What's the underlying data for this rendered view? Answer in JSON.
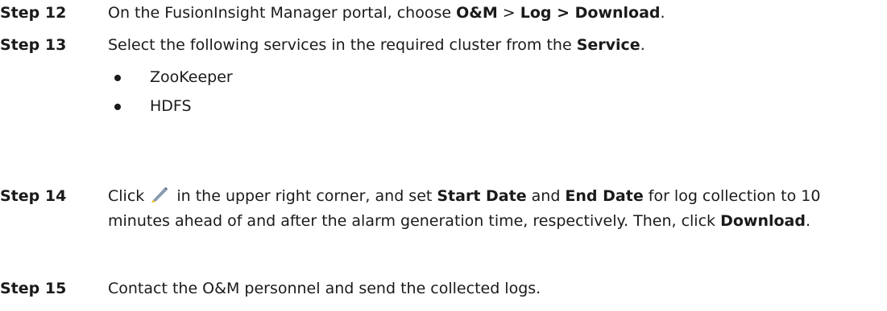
{
  "steps": [
    {
      "label": "Step 12",
      "text_1": "On the FusionInsight Manager portal, choose ",
      "bold_1": "O&M",
      "text_2": " > ",
      "bold_2": "Log > Download",
      "text_3": "."
    },
    {
      "label": "Step 13",
      "text_1": "Select the following services in the required cluster from the ",
      "bold_1": "Service",
      "text_2": ".",
      "bullets": [
        "ZooKeeper",
        "HDFS"
      ]
    },
    {
      "label": "Step 14",
      "text_1": "Click ",
      "icon": "pencil-edit-icon",
      "text_2": " in the upper right corner, and set ",
      "bold_1": "Start Date",
      "text_3": " and ",
      "bold_2": "End Date",
      "text_4": " for log collection to 10 minutes ahead of and after the alarm generation time, respectively. Then, click ",
      "bold_3": "Download",
      "text_5": "."
    },
    {
      "label": "Step 15",
      "text_1": "Contact the O&M personnel and send the collected logs."
    }
  ],
  "colors": {
    "text": "#1a1a1a",
    "pencil_body": "#8a9bb0",
    "pencil_tip": "#f0b400"
  }
}
